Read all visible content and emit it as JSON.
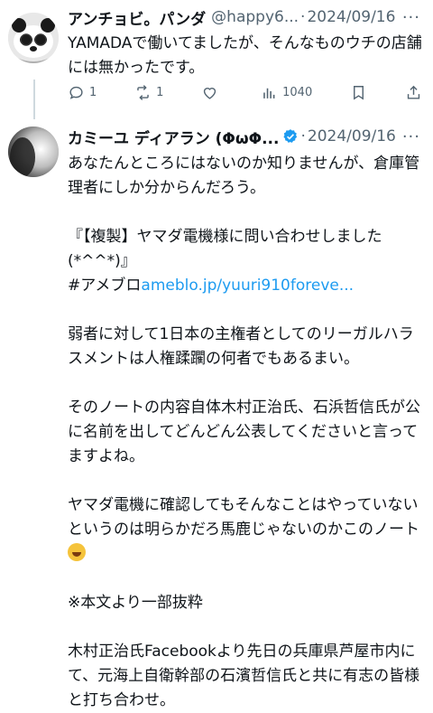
{
  "tweet1": {
    "display_name": "アンチョビ。パンダ",
    "handle": "@happy6...",
    "separator": "·",
    "date": "2024/09/16",
    "more": "···",
    "text": "YAMADAで働いてましたが、そんなものウチの店舗には無かったです。",
    "stats": {
      "replies": "1",
      "retweets": "1",
      "likes": "",
      "views": "1040"
    }
  },
  "tweet2": {
    "display_name": "カミーユ ディアラン (ΦωΦ...",
    "separator": "·",
    "date": "2024/09/16",
    "more": "···",
    "paragraphs": [
      "あなたんところにはないのか知りませんが、倉庫管理者にしか分からんだろう。",
      "",
      "『【複製】ヤマダ電機様に問い合わせしました(*^^*)』",
      "#アメブロ",
      "",
      "弱者に対して1日本の主権者としてのリーガルハラスメントは人権蹂躙の何者でもあるまい。",
      "",
      "そのノートの内容自体木村正治氏、石浜哲信氏が公に名前を出してどんどん公表してくださいと言ってますよね。",
      "",
      "ヤマダ電機に確認してもそんなことはやっていないというのは明らかだろ馬鹿じゃないのかこのノート",
      "",
      "※本文より一部抜粋",
      "",
      "木村正治氏Facebookより先日の兵庫県芦屋市内にて、元海上自衛幹部の石濱哲信氏と共に有志の皆様と打ち合わせ。"
    ],
    "link_text": "ameblo.jp/yuuri910foreve..."
  },
  "colors": {
    "text": "#0f1419",
    "muted": "#536471",
    "link": "#1d9bf0",
    "verified": "#1d9bf0"
  }
}
